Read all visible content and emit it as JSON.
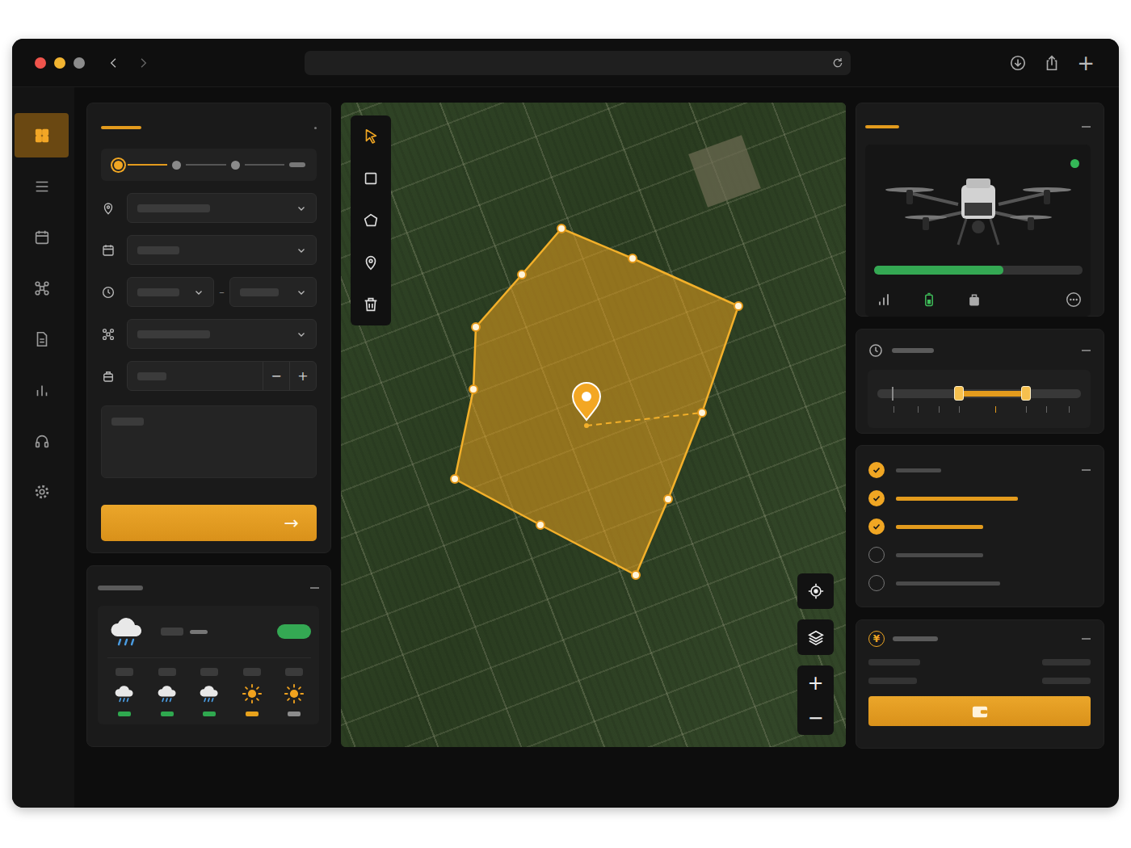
{
  "browser": {
    "traffic_lights": [
      {
        "color": "#f0544c"
      },
      {
        "color": "#f2b431"
      },
      {
        "color": "#8c8c8c"
      }
    ],
    "new_tab": "+"
  },
  "sidebar": {
    "items": [
      {
        "selected": true
      },
      {
        "selected": false
      },
      {
        "selected": false
      },
      {
        "selected": false
      },
      {
        "selected": false
      },
      {
        "selected": false
      },
      {
        "selected": false
      },
      {
        "selected": false
      }
    ]
  },
  "stepper": {
    "steps": [
      {
        "selected": true,
        "done": true
      },
      {
        "selected": false,
        "done": false
      },
      {
        "selected": false,
        "done": false
      },
      {
        "selected": false,
        "done": false
      }
    ]
  },
  "form": {
    "time_separator": "–",
    "payload": {
      "decrement": "−",
      "increment": "+"
    },
    "submit": {
      "icon": "→"
    }
  },
  "weather": {
    "toggle_on": true,
    "forecast": [
      {
        "kind": "rain",
        "color": "#2fa84f"
      },
      {
        "kind": "rain",
        "color": "#2fa84f"
      },
      {
        "kind": "rain",
        "color": "#2fa84f"
      },
      {
        "kind": "sun",
        "color": "#e8a21c"
      },
      {
        "kind": "sun",
        "color": "#8c8c8c"
      }
    ]
  },
  "map": {
    "tools": [
      {
        "selected": true
      },
      {
        "selected": false
      },
      {
        "selected": false
      },
      {
        "selected": false
      },
      {
        "selected": false
      }
    ],
    "zoom_in": "+",
    "zoom_out": "−"
  },
  "drone": {
    "online": true,
    "battery": {
      "level": 0.62
    }
  },
  "time_window": {
    "start": 0.4,
    "end": 0.73
  },
  "checklist": {
    "items": [
      {
        "checked": true,
        "highlighted": false
      },
      {
        "checked": true,
        "highlighted": true
      },
      {
        "checked": true,
        "highlighted": true
      },
      {
        "checked": false,
        "highlighted": false
      },
      {
        "checked": false,
        "highlighted": false
      }
    ]
  },
  "payment": {
    "currency": "¥"
  }
}
